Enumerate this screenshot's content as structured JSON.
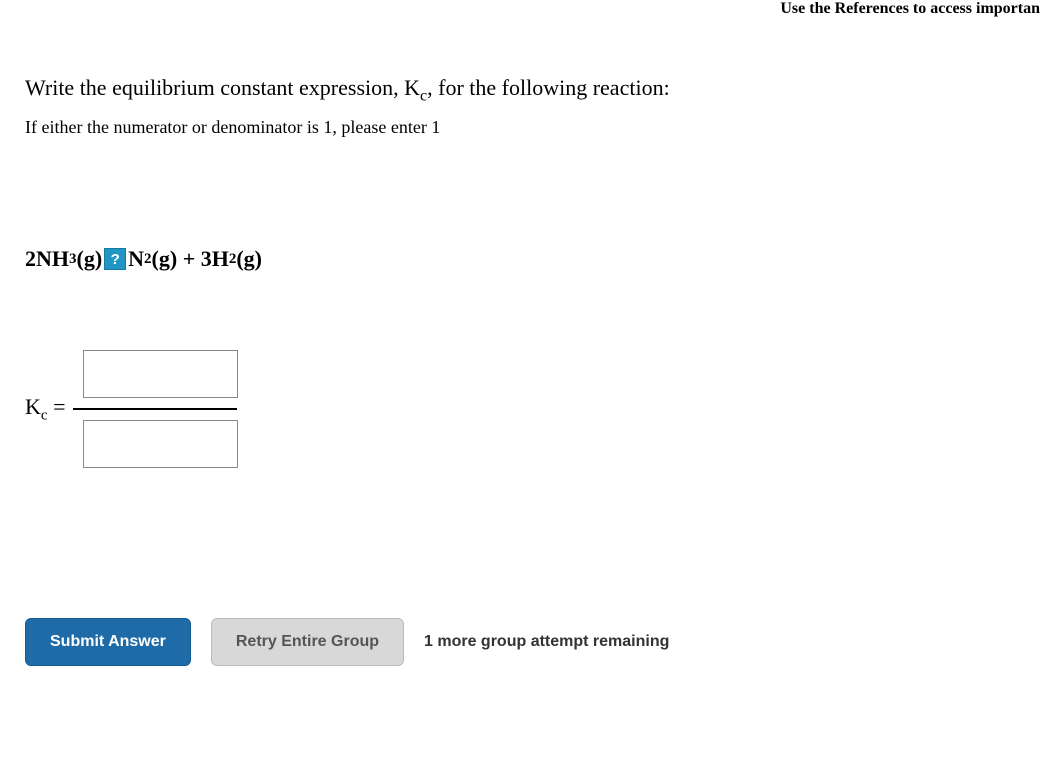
{
  "top_cutoff": "Use the References to access importan",
  "question": {
    "title_prefix": "Write the equilibrium constant expression, K",
    "title_sub": "c",
    "title_suffix": ", for the following reaction:",
    "instruction": "If either the numerator or denominator is 1, please enter 1"
  },
  "reaction": {
    "part1": "2NH",
    "sub1": "3",
    "part2": "(g) ",
    "help": "?",
    "part3": "N",
    "sub3": "2",
    "part4": "(g) + 3H",
    "sub4": "2",
    "part5": "(g)"
  },
  "equation": {
    "label_k": "K",
    "label_sub": "c",
    "label_equals": " = ",
    "numerator": "",
    "denominator": ""
  },
  "buttons": {
    "submit": "Submit Answer",
    "retry": "Retry Entire Group"
  },
  "attempts": "1 more group attempt remaining"
}
